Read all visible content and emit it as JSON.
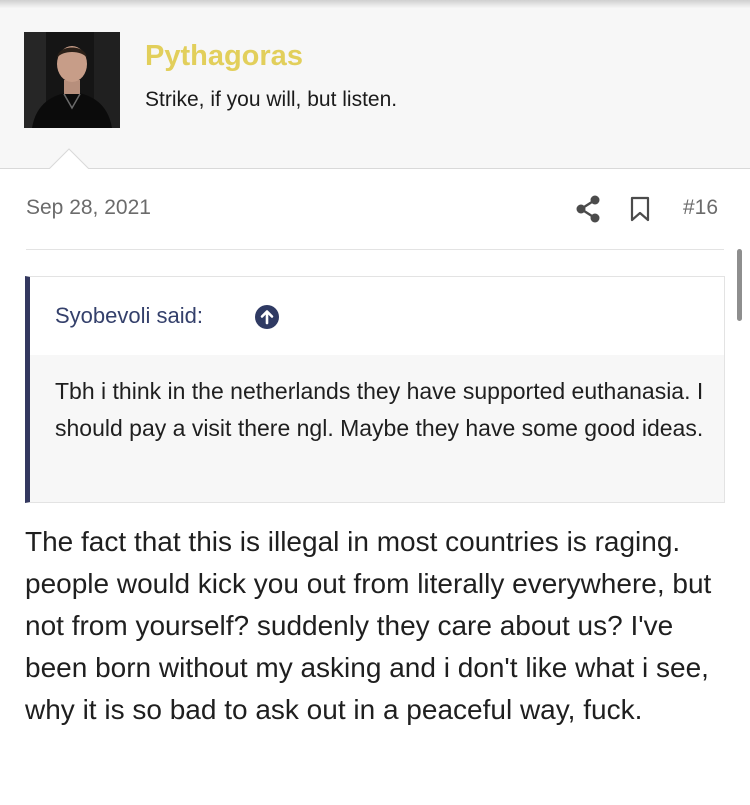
{
  "user": {
    "name": "Pythagoras",
    "title": "Strike, if you will, but listen.",
    "name_color": "#e2cf5b"
  },
  "post": {
    "date": "Sep 28, 2021",
    "number": "#16",
    "icons": [
      "share-icon",
      "bookmark-icon"
    ],
    "quote": {
      "author_line": "Syobevoli said:",
      "icon": "arrow-up-circle-icon",
      "text": "Tbh i think in the netherlands they have supported euthanasia. I should pay a visit there ngl. Maybe they have some good ideas.",
      "accent_color": "#33385f"
    },
    "body": "The fact that this is illegal in most countries is raging. people would kick you out from literally everywhere, but not from yourself? suddenly they care about us? I've been born without my asking and i don't like what i see, why it is so bad to ask out in a peaceful way, fuck."
  }
}
